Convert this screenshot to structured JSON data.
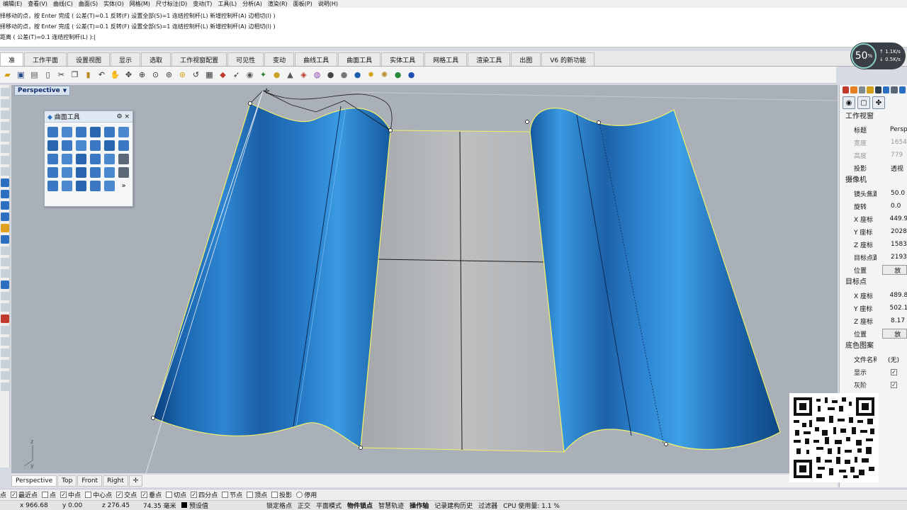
{
  "menubar": {
    "items": [
      "编辑(E)",
      "查看(V)",
      "曲线(C)",
      "曲面(S)",
      "实体(O)",
      "网格(M)",
      "尺寸标注(D)",
      "变动(T)",
      "工具(L)",
      "分析(A)",
      "渲染(R)",
      "面板(P)",
      "说明(H)"
    ]
  },
  "command": {
    "line1": "择移动的点，按 Enter 完成 ( 公差(T)=0.1  反转(F)  设置全部(S)=1  连结控制杆(L)  新增控制杆(A)  边相切(I) )",
    "line2": "择移动的点，按 Enter 完成 ( 公差(T)=0.1  反转(F)  设置全部(S)=1  连结控制杆(L)  新增控制杆(A)  边相切(I) )",
    "prompt": "距离 ( 公差(T)=0.1  连结控制杆(L) ):"
  },
  "tabs": [
    "准",
    "工作平面",
    "设置视图",
    "显示",
    "选取",
    "工作视窗配置",
    "可见性",
    "变动",
    "曲线工具",
    "曲面工具",
    "实体工具",
    "网格工具",
    "渲染工具",
    "出图",
    "V6 的新功能"
  ],
  "toolbar": {
    "icons": [
      "open-icon",
      "save-icon",
      "print-icon",
      "import-icon",
      "cut-icon",
      "copy-icon",
      "paste-icon",
      "undo-icon",
      "pan-icon",
      "rotate-view-icon",
      "zoom-icon",
      "zoom-window-icon",
      "zoom-extents-icon",
      "zoom-selected-icon",
      "undo-view-icon",
      "four-view-icon",
      "car-icon",
      "arrow-icon",
      "camera-icon",
      "gumball-icon",
      "lightbulb-icon",
      "lock-icon",
      "layer-icon",
      "color-icon",
      "sphere-icon",
      "render-sphere-icon",
      "environment-icon",
      "sun-icon",
      "gear-icon",
      "globe-icon",
      "help-icon"
    ]
  },
  "viewport": {
    "label": "Perspective",
    "axis_z": "z",
    "axis_y": "y"
  },
  "surface_panel": {
    "title": "曲面工具",
    "more": "»"
  },
  "viewport_tabs": [
    "Perspective",
    "Top",
    "Front",
    "Right"
  ],
  "osnap": {
    "items": [
      {
        "label": "点",
        "checked": false
      },
      {
        "label": "最近点",
        "checked": true
      },
      {
        "label": "点",
        "checked": false
      },
      {
        "label": "中点",
        "checked": true
      },
      {
        "label": "中心点",
        "checked": false
      },
      {
        "label": "交点",
        "checked": true
      },
      {
        "label": "垂点",
        "checked": true
      },
      {
        "label": "切点",
        "checked": false
      },
      {
        "label": "四分点",
        "checked": true
      },
      {
        "label": "节点",
        "checked": false
      },
      {
        "label": "顶点",
        "checked": false
      },
      {
        "label": "投影",
        "checked": false
      },
      {
        "label": "停用",
        "checked": false
      }
    ]
  },
  "status": {
    "x": "x 966.68",
    "y": "y 0.00",
    "z": "z 276.45",
    "distance": "74.35 毫米",
    "layer": "预设值",
    "items": [
      "锁定格点",
      "正交",
      "平面模式",
      "物件锁点",
      "智慧轨迹",
      "操作轴",
      "记录建构历史",
      "过滤器",
      "CPU 使用量: 1.1 %"
    ]
  },
  "right_panel": {
    "viewport_section": "工作视窗",
    "rows_viewport": [
      {
        "k": "标题",
        "v": "Persp",
        "disabled": false
      },
      {
        "k": "宽度",
        "v": "1654",
        "disabled": true
      },
      {
        "k": "高度",
        "v": "779",
        "disabled": true
      },
      {
        "k": "投影",
        "v": "透视",
        "disabled": false
      }
    ],
    "camera_section": "摄像机",
    "rows_camera": [
      {
        "k": "镜头焦距",
        "v": "50.0"
      },
      {
        "k": "旋转",
        "v": "0.0"
      },
      {
        "k": "X 座标",
        "v": "449.9"
      },
      {
        "k": "Y 座标",
        "v": "2028"
      },
      {
        "k": "Z 座标",
        "v": "1583"
      },
      {
        "k": "目标点距离",
        "v": "2193"
      }
    ],
    "position_label": "位置",
    "position_btn": "放",
    "target_section": "目标点",
    "rows_target": [
      {
        "k": "X 座标",
        "v": "489.8"
      },
      {
        "k": "Y 座标",
        "v": "502.1"
      },
      {
        "k": "Z 座标",
        "v": "8.17"
      }
    ],
    "target_position_label": "位置",
    "target_position_btn": "放",
    "wallpaper_section": "底色图案",
    "filename_label": "文件名称",
    "filename_value": "(无)",
    "show_label": "显示",
    "gray_label": "灰阶",
    "check": "✓"
  },
  "speed": {
    "percent": "50",
    "unit": "%",
    "up": "1.1K/s",
    "down": "0.5K/s"
  },
  "colors": {
    "surface_blue": "#1f6fb8",
    "surface_gray": "#b4b6b8",
    "viewport_bg": "#a9b0b8",
    "edge_yellow": "#f2f06a"
  }
}
